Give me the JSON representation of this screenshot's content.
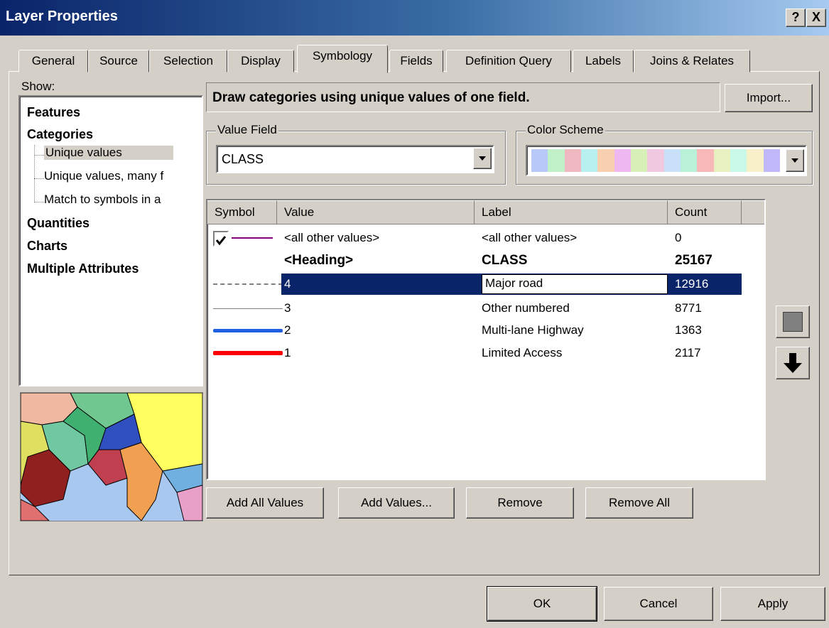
{
  "window": {
    "title": "Layer Properties",
    "help_label": "?",
    "close_label": "X"
  },
  "tabs": [
    {
      "label": "General"
    },
    {
      "label": "Source"
    },
    {
      "label": "Selection"
    },
    {
      "label": "Display"
    },
    {
      "label": "Symbology",
      "active": true
    },
    {
      "label": "Fields"
    },
    {
      "label": "Definition Query"
    },
    {
      "label": "Labels"
    },
    {
      "label": "Joins & Relates"
    }
  ],
  "show": {
    "label": "Show:",
    "items": [
      {
        "label": "Features"
      },
      {
        "label": "Categories"
      },
      {
        "label": "Unique values"
      },
      {
        "label": "Unique values, many f"
      },
      {
        "label": "Match to symbols in a"
      },
      {
        "label": "Quantities"
      },
      {
        "label": "Charts"
      },
      {
        "label": "Multiple Attributes"
      }
    ]
  },
  "description": "Draw categories using unique values of one field.",
  "import_button": "Import...",
  "value_field": {
    "group_label": "Value Field",
    "value": "CLASS"
  },
  "color_scheme": {
    "group_label": "Color Scheme",
    "swatches": [
      "#b8c8f8",
      "#c0f0c8",
      "#f0b8c0",
      "#b8f0f0",
      "#f8d0b0",
      "#f0b8f0",
      "#d8f0b8",
      "#f0c8e0",
      "#c8e0f8",
      "#b8f0d8",
      "#f8b8b8",
      "#e8f0c0",
      "#c8f8e8",
      "#f8f0c8",
      "#c0b8f8"
    ]
  },
  "table": {
    "columns": [
      "Symbol",
      "Value",
      "Label",
      "Count"
    ],
    "rows": [
      {
        "symbol_color": "#800080",
        "symbol_style": "thin",
        "checkbox": true,
        "value": "<all other values>",
        "label": "<all other values>",
        "count": "0"
      },
      {
        "heading": true,
        "value": "<Heading>",
        "label": "CLASS",
        "count": "25167"
      },
      {
        "symbol_color": "#808080",
        "symbol_style": "dashed",
        "value": "4",
        "label": "Major road",
        "count": "12916",
        "selected": true
      },
      {
        "symbol_color": "#808080",
        "symbol_style": "thin",
        "value": "3",
        "label": "Other numbered",
        "count": "8771"
      },
      {
        "symbol_color": "#2060e0",
        "symbol_style": "thick",
        "value": "2",
        "label": "Multi-lane Highway",
        "count": "1363"
      },
      {
        "symbol_color": "#ff0000",
        "symbol_style": "thick",
        "value": "1",
        "label": "Limited Access",
        "count": "2117"
      }
    ]
  },
  "buttons": {
    "add_all": "Add All Values",
    "add": "Add Values...",
    "remove": "Remove",
    "remove_all": "Remove All",
    "ok": "OK",
    "cancel": "Cancel",
    "apply": "Apply"
  },
  "icons": {
    "move_up": "square-icon",
    "move_down": "down-arrow-icon"
  }
}
